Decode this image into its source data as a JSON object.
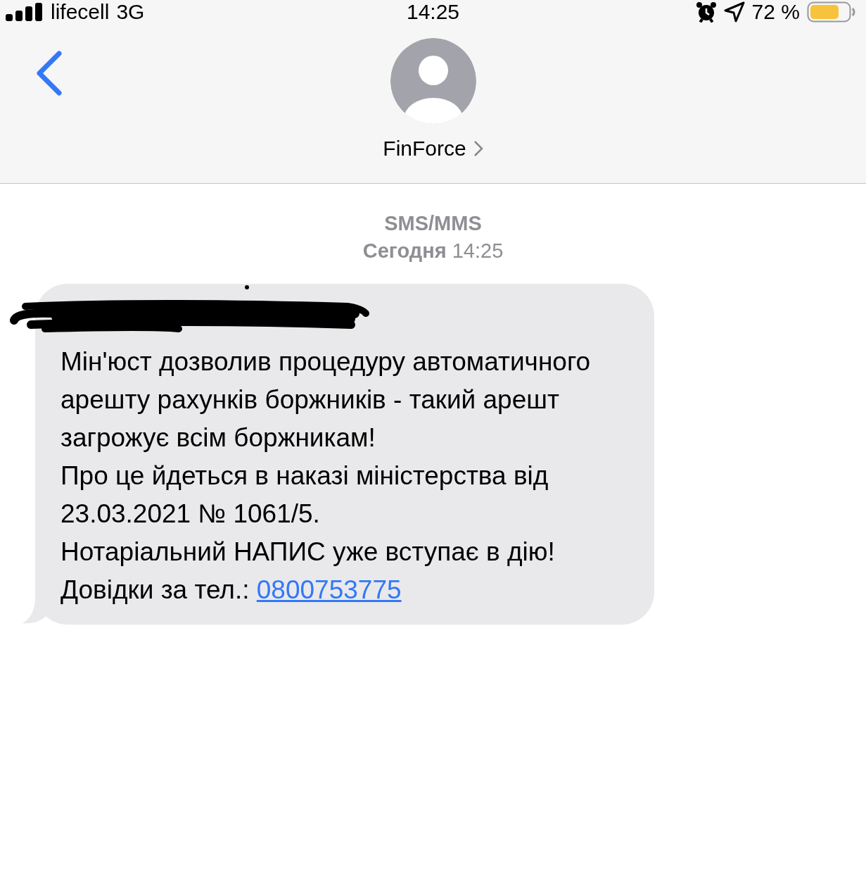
{
  "status_bar": {
    "carrier": "lifecell",
    "network": "3G",
    "time": "14:25",
    "battery": "72 %"
  },
  "header": {
    "contact": "FinForce"
  },
  "thread": {
    "service": "SMS/MMS",
    "timestamp": "**Сегодня** 14:25"
  },
  "message": {
    "redacted": true,
    "text": "Мін'юст дозволив процедуру автоматичного арешту рахунків боржників - такий арешт загрожує всім боржникам!\nПро це йдеться в наказі міністерства від 23.03.2021 № 1061/5.\nНотаріальний НАПИС уже вступає в дію!\nДовідки за тел.: ",
    "link": "0800753775"
  }
}
